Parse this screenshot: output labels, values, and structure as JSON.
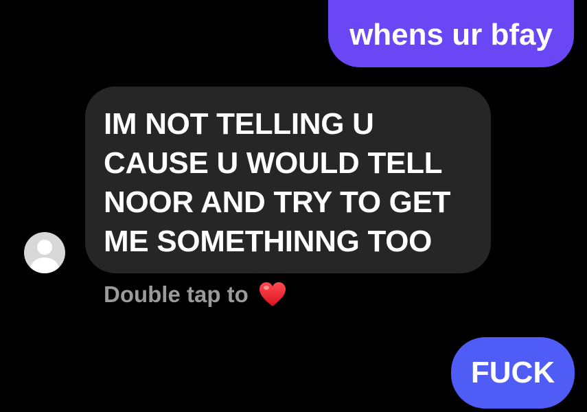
{
  "colors": {
    "background": "#000000",
    "outgoing_bubble_top": "#6a47f5",
    "outgoing_bubble_bottom": "#4f5cf6",
    "incoming_bubble": "#262626",
    "hint_text": "#9a9a9a",
    "heart": "#e8202a"
  },
  "messages": [
    {
      "direction": "outgoing",
      "text": "whens ur bfay"
    },
    {
      "direction": "incoming",
      "lines": [
        "IM NOT TELLING U",
        "CAUSE U WOULD TELL",
        "NOOR AND TRY TO GET",
        "ME SOMETHINNG TOO"
      ],
      "avatar_icon": "default-profile-icon"
    },
    {
      "direction": "outgoing",
      "text": "FUCK"
    }
  ],
  "reaction_hint": {
    "label": "Double tap to",
    "icon": "heart-icon"
  }
}
